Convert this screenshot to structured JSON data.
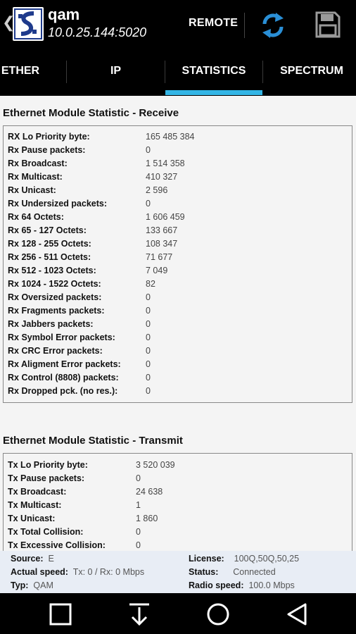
{
  "app": {
    "title": "qam",
    "subtitle": "10.0.25.144:5020",
    "remote_label": "REMOTE"
  },
  "tabs": [
    {
      "label": "ETHER"
    },
    {
      "label": "IP"
    },
    {
      "label": "STATISTICS"
    },
    {
      "label": "SPECTRUM"
    }
  ],
  "receive": {
    "title": "Ethernet Module Statistic - Receive",
    "rows": [
      {
        "label": "RX Lo Priority byte:",
        "value": "165 485 384"
      },
      {
        "label": "Rx Pause packets:",
        "value": "0"
      },
      {
        "label": "Rx Broadcast:",
        "value": "1 514 358"
      },
      {
        "label": "Rx Multicast:",
        "value": "410 327"
      },
      {
        "label": "Rx Unicast:",
        "value": "2 596"
      },
      {
        "label": "Rx Undersized packets:",
        "value": "0"
      },
      {
        "label": "Rx 64 Octets:",
        "value": "1 606 459"
      },
      {
        "label": "Rx 65 - 127 Octets:",
        "value": "133 667"
      },
      {
        "label": "Rx 128 - 255 Octets:",
        "value": "108 347"
      },
      {
        "label": "Rx 256 - 511 Octets:",
        "value": "71 677"
      },
      {
        "label": "Rx 512 - 1023 Octets:",
        "value": "7 049"
      },
      {
        "label": "Rx 1024 - 1522 Octets:",
        "value": "82"
      },
      {
        "label": "Rx Oversized packets:",
        "value": "0"
      },
      {
        "label": "Rx Fragments packets:",
        "value": "0"
      },
      {
        "label": "Rx Jabbers packets:",
        "value": "0"
      },
      {
        "label": "Rx Symbol Error packets:",
        "value": "0"
      },
      {
        "label": "Rx CRC Error packets:",
        "value": "0"
      },
      {
        "label": "Rx Aligment Error packets:",
        "value": "0"
      },
      {
        "label": "Rx Control (8808) packets:",
        "value": "0"
      },
      {
        "label": "Rx Dropped pck. (no res.):",
        "value": "0"
      }
    ]
  },
  "transmit": {
    "title": "Ethernet Module Statistic - Transmit",
    "rows": [
      {
        "label": "Tx Lo Priority byte:",
        "value": "3 520 039"
      },
      {
        "label": "Tx Pause packets:",
        "value": "0"
      },
      {
        "label": "Tx Broadcast:",
        "value": "24 638"
      },
      {
        "label": "Tx Multicast:",
        "value": "1"
      },
      {
        "label": "Tx Unicast:",
        "value": "1 860"
      },
      {
        "label": "Tx Total Collision:",
        "value": "0"
      },
      {
        "label": "Tx Excessive Collision:",
        "value": "0"
      }
    ]
  },
  "info": {
    "source_label": "Source:",
    "source_value": "E",
    "speed_label": "Actual speed:",
    "speed_value": "Tx: 0 / Rx: 0 Mbps",
    "type_label": "Typ:",
    "type_value": "QAM",
    "license_label": "License:",
    "license_value": "100Q,50Q,50,25",
    "status_label": "Status:",
    "status_value": "Connected",
    "radio_label": "Radio speed:",
    "radio_value": "100.0 Mbps"
  },
  "colors": {
    "accent": "#33b5e5",
    "refresh_icon": "#2a8fd6",
    "logo": "#1f3b8c"
  },
  "icons": {
    "back": "chevron-left-icon",
    "logo": "app-logo",
    "refresh": "refresh-icon",
    "save": "save-icon",
    "nav_recent": "recent-apps-icon",
    "nav_download": "download-icon",
    "nav_home": "home-icon",
    "nav_back": "back-triangle-icon"
  }
}
